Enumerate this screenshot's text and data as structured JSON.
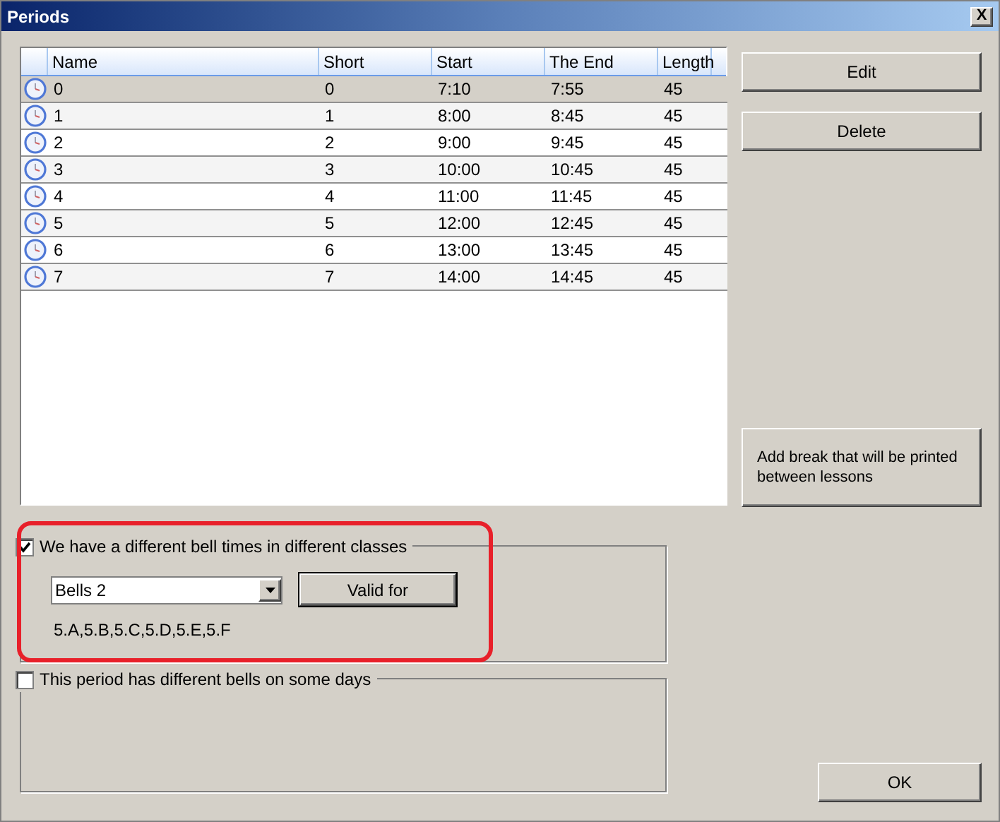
{
  "window": {
    "title": "Periods",
    "close": "X"
  },
  "table": {
    "columns": [
      "Name",
      "Short",
      "Start",
      "The End",
      "Length"
    ],
    "rows": [
      {
        "cells": [
          "0",
          "0",
          "7:10",
          "7:55",
          "45"
        ],
        "selected": true
      },
      {
        "cells": [
          "1",
          "1",
          "8:00",
          "8:45",
          "45"
        ],
        "selected": false
      },
      {
        "cells": [
          "2",
          "2",
          "9:00",
          "9:45",
          "45"
        ],
        "selected": false
      },
      {
        "cells": [
          "3",
          "3",
          "10:00",
          "10:45",
          "45"
        ],
        "selected": false
      },
      {
        "cells": [
          "4",
          "4",
          "11:00",
          "11:45",
          "45"
        ],
        "selected": false
      },
      {
        "cells": [
          "5",
          "5",
          "12:00",
          "12:45",
          "45"
        ],
        "selected": false
      },
      {
        "cells": [
          "6",
          "6",
          "13:00",
          "13:45",
          "45"
        ],
        "selected": false
      },
      {
        "cells": [
          "7",
          "7",
          "14:00",
          "14:45",
          "45"
        ],
        "selected": false
      }
    ]
  },
  "buttons": {
    "edit": "Edit",
    "delete": "Delete",
    "add_break": "Add break that will be printed between lessons",
    "ok": "OK"
  },
  "bell_group": {
    "label": "We have a different bell times in different classes",
    "checked": true,
    "dropdown": "Bells 2",
    "valid_for": "Valid for",
    "classes": "5.A,5.B,5.C,5.D,5.E,5.F",
    "highlighted": true
  },
  "days_group": {
    "label": "This period has different bells on some days",
    "checked": false
  }
}
